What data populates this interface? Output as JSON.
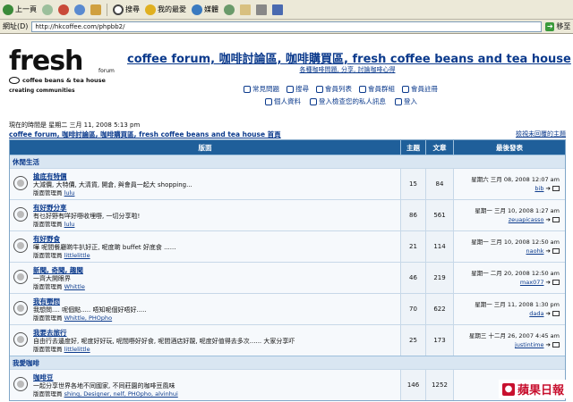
{
  "toolbar": {
    "back_label": "上一頁",
    "search_label": "搜尋",
    "favorites_label": "我的最愛",
    "media_label": "媒體"
  },
  "address": {
    "label": "網址(D)",
    "url": "http://hkcoffee.com/phpbb2/",
    "go_label": "移至"
  },
  "header": {
    "logo_text": "fresh",
    "logo_forum": "forum",
    "logo_sub": "coffee beans & tea house",
    "logo_tag": "creating communities",
    "title": "coffee forum, 咖啡討論區, 咖啡購買區, fresh coffee beans and tea house",
    "description": "各種咖啡問題, 分享, 討論咖啡心得",
    "nav_row1": [
      "常見問題",
      "搜尋",
      "會員列表",
      "會員群組",
      "會員註冊"
    ],
    "nav_row2": [
      "個人資料",
      "登入檢查您的私人訊息",
      "登入"
    ]
  },
  "status": {
    "now": "現在的時間是 星期二 三月 11, 2008 5:13 pm",
    "breadcrumb": "coffee forum, 咖啡討論區, 咖啡購買區, fresh coffee beans and tea house 首頁",
    "unread": "檢視未回覆的主題"
  },
  "table": {
    "headers": {
      "forum": "版面",
      "topics": "主題",
      "posts": "文章",
      "last": "最後發表"
    },
    "category1": "休閒生活",
    "category2": "我愛咖啡",
    "mod_label": "版面管理員",
    "rows": [
      {
        "name": "搶底有特價",
        "desc": "大減價, 大特價, 大清貨, 開倉, 與會員一起大 shopping...",
        "mods": "lulu",
        "topics": "15",
        "posts": "84",
        "last_date": "星期六 三月 08, 2008 12:07 am",
        "last_user": "bib"
      },
      {
        "name": "有好野分享",
        "desc": "有乜好野有咩好嘢收埋嘢, 一切分享啦!",
        "mods": "lulu",
        "topics": "86",
        "posts": "561",
        "last_date": "星期一 三月 10, 2008 1:27 am",
        "last_user": "zeuapicasso"
      },
      {
        "name": "有好野食",
        "desc": "嘩 呢間餐廳啲牛扒好正, 呢度啲 buffet 好底食 ......",
        "mods": "littlelittle",
        "topics": "21",
        "posts": "114",
        "last_date": "星期一 三月 10, 2008 12:50 am",
        "last_user": "naohk"
      },
      {
        "name": "新聞, 奇聞, 趣聞",
        "desc": "一齊大開眼界",
        "mods": "Whittle",
        "topics": "46",
        "posts": "219",
        "last_date": "星期一 二月 20, 2008 12:50 am",
        "last_user": "max077"
      },
      {
        "name": "我有嘢問",
        "desc": "我想問.... 呢個點..... 唔知呢個好唔好.....",
        "mods": "Whittle, PHOpho",
        "topics": "70",
        "posts": "622",
        "last_date": "星期一 三月 11, 2008 1:30 pm",
        "last_user": "dada"
      },
      {
        "name": "我要去旅行",
        "desc": "自由行去邊度好, 呢度好好玩, 呢間嘢好好食, 呢間酒店好靚, 呢度好值得去多次...... 大家分享吓",
        "mods": "littlelittle",
        "topics": "25",
        "posts": "173",
        "last_date": "星期三 十二月 26, 2007 4:45 am",
        "last_user": "justintime"
      },
      {
        "name": "咖啡豆",
        "desc": "一起分享世界各地不同國家, 不同莊園的咖啡豆風味",
        "mods": "shing, Designer, nelf, PHOpho, alvinhui",
        "topics": "146",
        "posts": "1252",
        "last_date": "",
        "last_user": ""
      }
    ]
  },
  "watermark": {
    "text": "蘋果日報"
  },
  "colors": {
    "header_bg": "#1f5f9a",
    "link": "#0b3a8c",
    "category_bg": "#d9e6f2",
    "brand_red": "#c8102e"
  }
}
